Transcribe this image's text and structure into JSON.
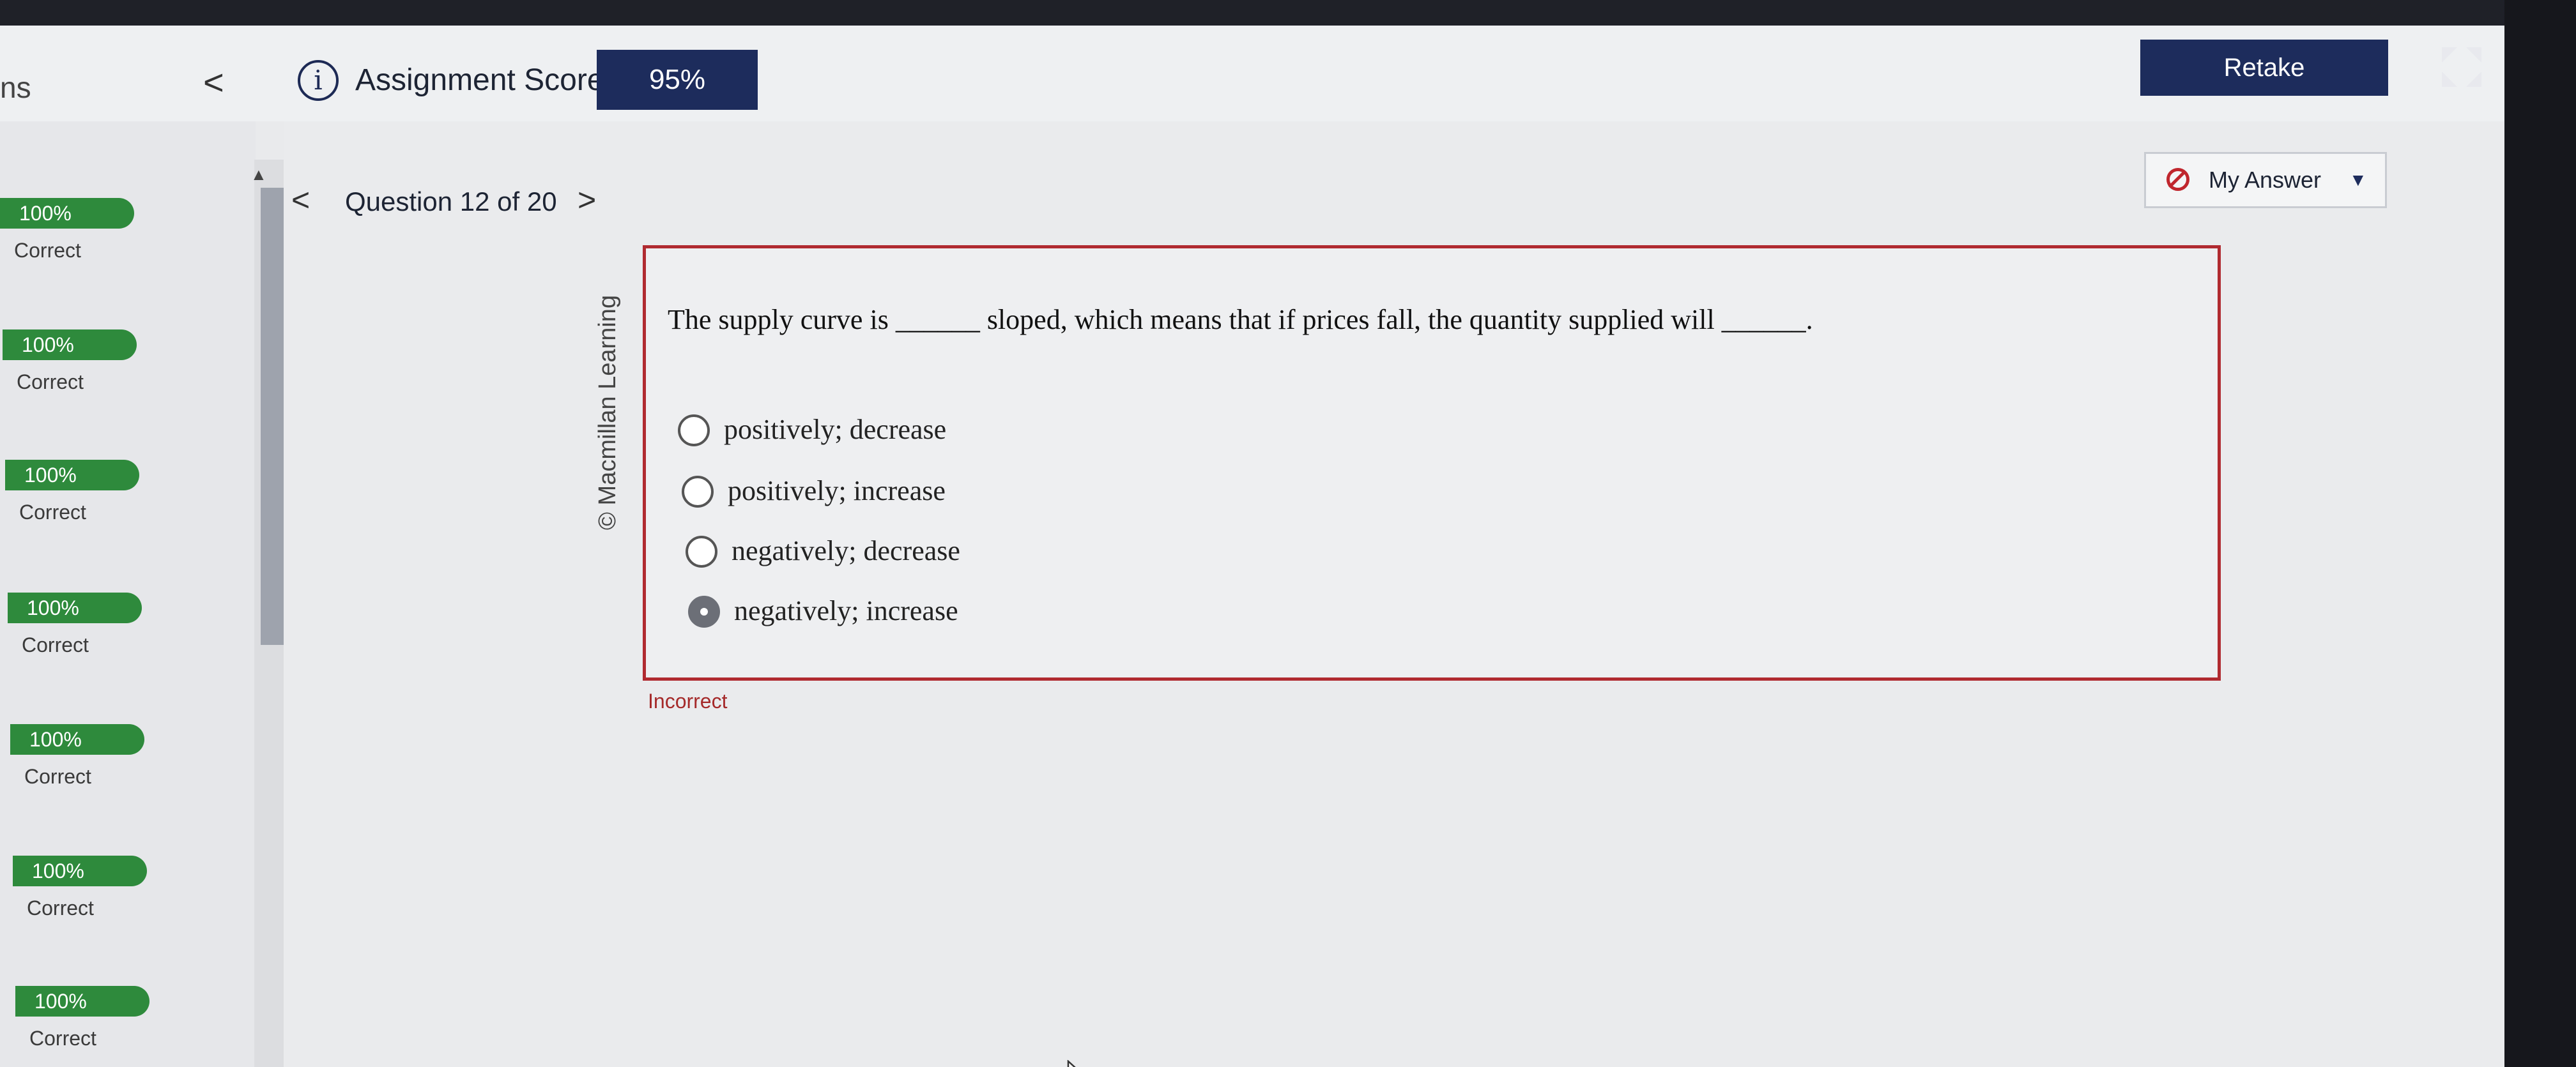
{
  "header": {
    "left_title": "ns",
    "back_label": "<",
    "score_label": "Assignment Score:",
    "score_value": "95%",
    "retake_label": "Retake",
    "info_icon_glyph": "i"
  },
  "sidebar": {
    "items": [
      {
        "score": "100%",
        "status": "Correct"
      },
      {
        "score": "100%",
        "status": "Correct"
      },
      {
        "score": "100%",
        "status": "Correct"
      },
      {
        "score": "100%",
        "status": "Correct"
      },
      {
        "score": "100%",
        "status": "Correct"
      },
      {
        "score": "100%",
        "status": "Correct"
      },
      {
        "score": "100%",
        "status": "Correct"
      }
    ]
  },
  "question_nav": {
    "prev": "<",
    "title": "Question 12 of 20",
    "next": ">"
  },
  "answer_toggle": {
    "label": "My Answer",
    "caret": "▼"
  },
  "question": {
    "copyright": "© Macmillan Learning",
    "text": "The supply curve is ______ sloped, which means that if prices fall, the quantity supplied will ______.",
    "options": [
      {
        "label": "positively; decrease",
        "selected": false
      },
      {
        "label": "positively; increase",
        "selected": false
      },
      {
        "label": "negatively; decrease",
        "selected": false
      },
      {
        "label": "negatively; increase",
        "selected": true
      }
    ],
    "feedback": "Incorrect"
  },
  "colors": {
    "navy": "#1d2c5c",
    "correct_green": "#2e8a3c",
    "incorrect_red": "#b02a30"
  }
}
